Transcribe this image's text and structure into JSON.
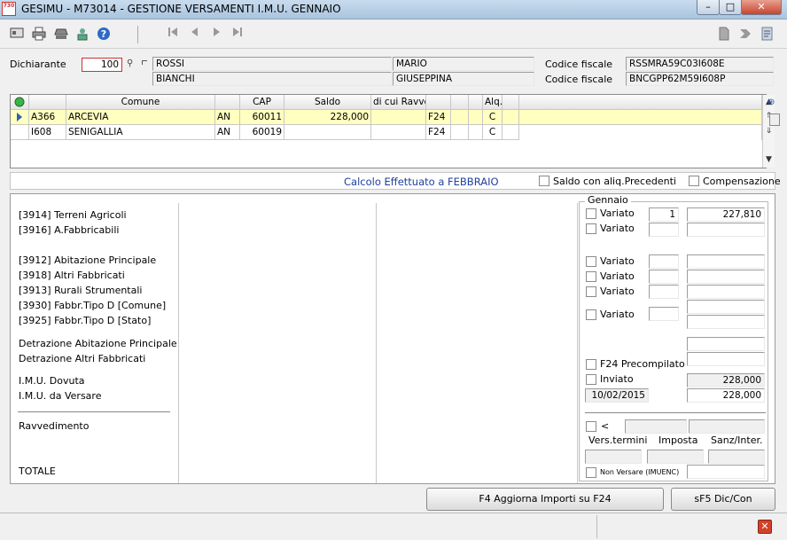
{
  "window": {
    "app_icon_text": "730",
    "title": "GESIMU  - M73014 -  GESTIONE VERSAMENTI I.M.U. GENNAIO"
  },
  "toolbar": {
    "icons_left": [
      "card-icon",
      "print-icon",
      "stamp-icon",
      "user-download-icon",
      "help-icon"
    ],
    "nav": [
      "first-icon",
      "prev-icon",
      "next-icon",
      "last-icon"
    ],
    "icons_right": [
      "blank-page-icon",
      "forward-icon",
      "notes-icon"
    ]
  },
  "header": {
    "dichiarante_label": "Dichiarante",
    "dichiarante_value": "100",
    "cognome1": "ROSSI",
    "nome1": "MARIO",
    "cognome2": "BIANCHI",
    "nome2": "GIUSEPPINA",
    "cf_label1": "Codice fiscale",
    "cf_value1": "RSSMRA59C03I608E",
    "cf_label2": "Codice fiscale",
    "cf_value2": "BNCGPP62M59I608P"
  },
  "grid": {
    "columns": [
      "",
      "",
      "Comune",
      "",
      "CAP",
      "Saldo",
      "di cui Ravved",
      "",
      "",
      "",
      "Alq.",
      "",
      ""
    ],
    "rows": [
      {
        "code": "A366",
        "comune": "ARCEVIA",
        "prov": "AN",
        "cap": "60011",
        "saldo": "228,000",
        "ravv": "",
        "tipo": "F24",
        "alq": "C"
      },
      {
        "code": "I608",
        "comune": "SENIGALLIA",
        "prov": "AN",
        "cap": "60019",
        "saldo": "",
        "ravv": "",
        "tipo": "F24",
        "alq": "C"
      }
    ]
  },
  "calc": {
    "text": "Calcolo Effettuato a FEBBRAIO",
    "saldo_precedenti": "Saldo con aliq.Precedenti",
    "compensazione": "Compensazione"
  },
  "labels": {
    "terreni": "[3914] Terreni Agricoli",
    "fabbricabili": "[3916] A.Fabbricabili",
    "abitazione": "[3912] Abitazione Principale",
    "altri": "[3918] Altri Fabbricati",
    "rurali": "[3913] Rurali Strumentali",
    "tipo_d_comune": "[3930] Fabbr.Tipo D [Comune]",
    "tipo_d_stato": "[3925] Fabbr.Tipo D [Stato]",
    "detr_abitazione": "Detrazione Abitazione Principale",
    "detr_altri": "Detrazione Altri Fabbricati",
    "imu_dovuta": "I.M.U. Dovuta",
    "imu_versare": "I.M.U. da Versare",
    "ravvedimento": "Ravvedimento",
    "totale": "TOTALE"
  },
  "gennaio": {
    "title": "Gennaio",
    "variato": "Variato",
    "terreni_count": "1",
    "terreni_amount": "227,810",
    "f24_precompilato": "F24 Precompilato",
    "inviato": "Inviato",
    "dovuta": "228,000",
    "date": "10/02/2015",
    "versare": "228,000",
    "lt": "<",
    "vers_termini": "Vers.termini",
    "imposta": "Imposta",
    "sanz_inter": "Sanz/Inter.",
    "non_versare": "Non Versare (IMUENC)"
  },
  "buttons": {
    "aggiorna": "F4   Aggiorna Importi su F24",
    "dic_con": "sF5 Dic/Con"
  }
}
